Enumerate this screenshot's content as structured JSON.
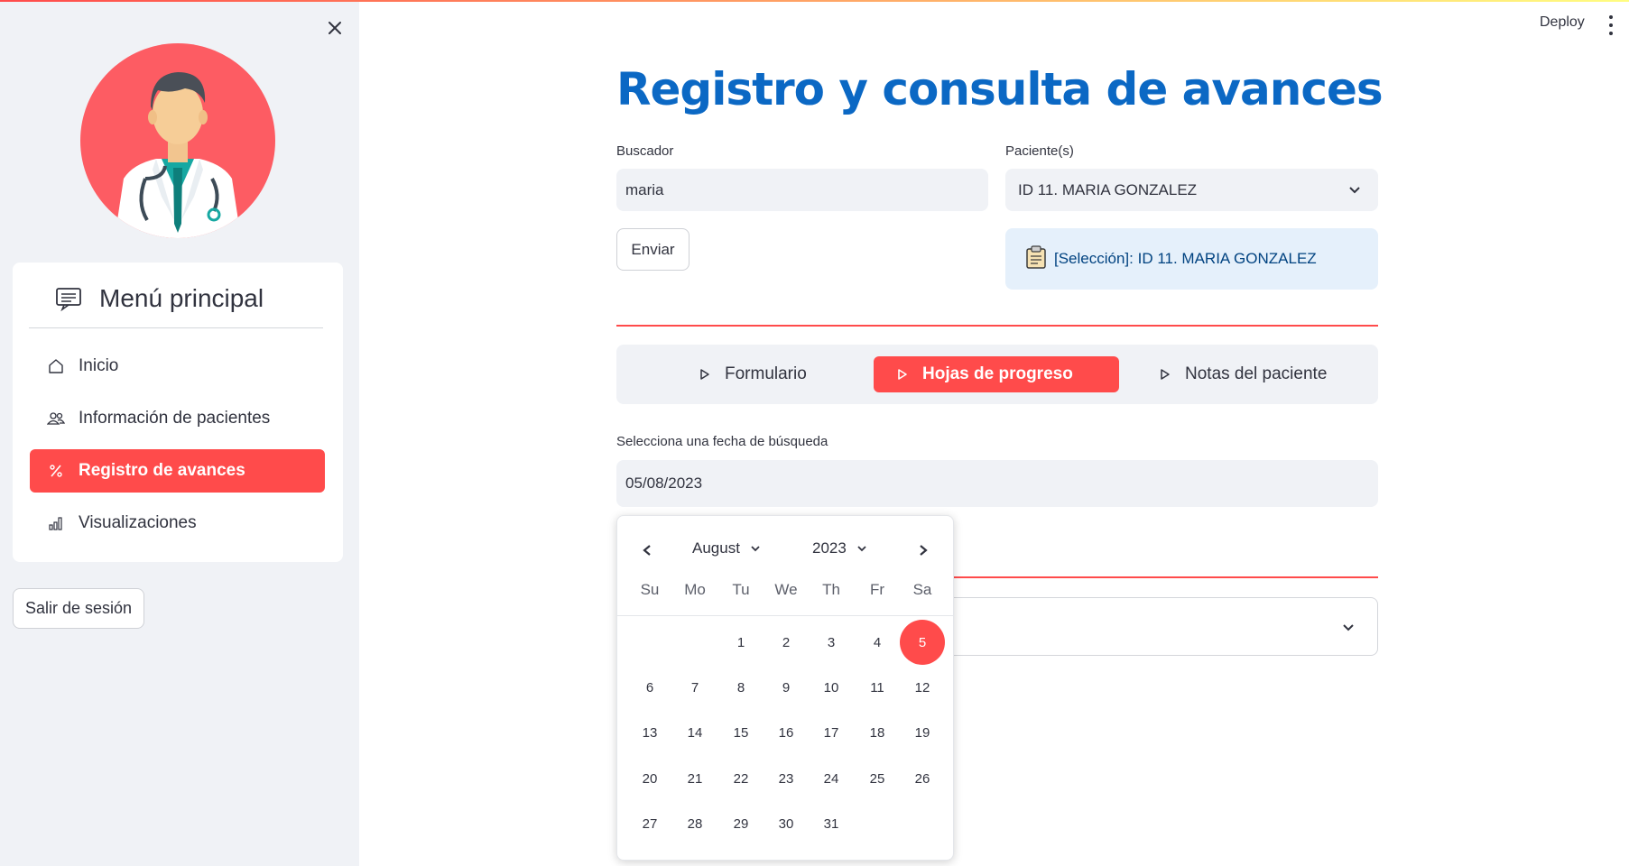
{
  "sidebar": {
    "menu_title": "Menú principal",
    "items": [
      {
        "label": "Inicio",
        "icon": "house-icon"
      },
      {
        "label": "Información de pacientes",
        "icon": "people-icon"
      },
      {
        "label": "Registro de avances",
        "icon": "percent-icon",
        "active": true
      },
      {
        "label": "Visualizaciones",
        "icon": "bar-chart-icon"
      }
    ],
    "logout_label": "Salir de sesión"
  },
  "header": {
    "deploy_label": "Deploy"
  },
  "main": {
    "title": "Registro y consulta de avances",
    "search": {
      "label": "Buscador",
      "value": "maria"
    },
    "patients": {
      "label": "Paciente(s)",
      "selected": "ID 11. MARIA GONZALEZ"
    },
    "submit_label": "Enviar",
    "selection_info": "[Selección]: ID 11. MARIA GONZALEZ",
    "tabs": [
      {
        "label": "Formulario"
      },
      {
        "label": "Hojas de progreso",
        "active": true
      },
      {
        "label": "Notas del paciente"
      }
    ],
    "date": {
      "label": "Selecciona una fecha de búsqueda",
      "value": "05/08/2023"
    }
  },
  "calendar": {
    "month": "August",
    "year": "2023",
    "weekdays": [
      "Su",
      "Mo",
      "Tu",
      "We",
      "Th",
      "Fr",
      "Sa"
    ],
    "selected_day": "5",
    "days": [
      "1",
      "2",
      "3",
      "4",
      "5",
      "6",
      "7",
      "8",
      "9",
      "10",
      "11",
      "12",
      "13",
      "14",
      "15",
      "16",
      "17",
      "18",
      "19",
      "20",
      "21",
      "22",
      "23",
      "24",
      "25",
      "26",
      "27",
      "28",
      "29",
      "30",
      "31"
    ]
  },
  "colors": {
    "accent": "#ff4b4b",
    "title": "#0b68c4",
    "info_bg": "#e5f0fb",
    "info_text": "#004280"
  }
}
